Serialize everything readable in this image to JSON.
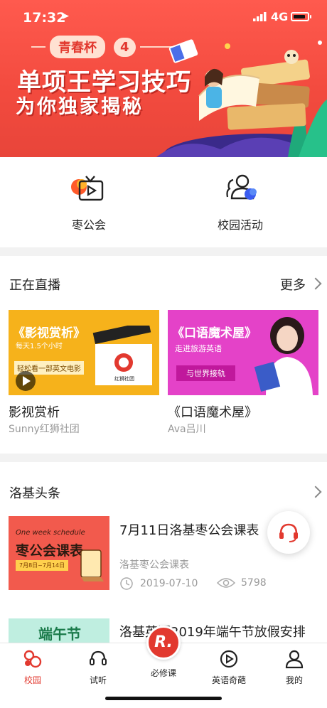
{
  "status": {
    "time": "17:32",
    "network": "4G"
  },
  "banner": {
    "tag": "青春杯",
    "tag_num": "4",
    "headline": "单项王学习技巧",
    "subline": "为你独家揭秘"
  },
  "categories": [
    {
      "label": "枣公会",
      "icon": "tv-play-icon"
    },
    {
      "label": "校园活动",
      "icon": "people-icon"
    }
  ],
  "live": {
    "section_title": "正在直播",
    "more_label": "更多",
    "cards": [
      {
        "poster_title": "《影视赏析》",
        "poster_line1": "每天1.5个小时",
        "poster_line2": "轻松看一部英文电影",
        "poster_brand": "红狮社团",
        "title": "影视赏析",
        "host": "Sunny红狮社团"
      },
      {
        "poster_title": "《口语魔术屋》",
        "poster_line1": "走进旅游英语",
        "poster_line2": "与世界接轨",
        "title": "《口语魔术屋》",
        "host": "Ava吕川"
      }
    ]
  },
  "news": {
    "section_title": "洛基头条",
    "items": [
      {
        "thumb_top": "One week schedule",
        "thumb_main": "枣公会课表",
        "thumb_date": "7月8日~7月14日",
        "title": "7月11日洛基枣公会课表",
        "source": "洛基枣公会课表",
        "date": "2019-07-10",
        "views": "5798"
      },
      {
        "thumb_main": "端午节",
        "title": "洛基英语2019年端午节放假安排"
      }
    ]
  },
  "tabbar": {
    "tabs": [
      {
        "label": "校园",
        "icon": "campus-icon",
        "active": true
      },
      {
        "label": "试听",
        "icon": "headset-icon",
        "active": false
      },
      {
        "label": "必修课",
        "icon": "logo-r-icon",
        "active": false
      },
      {
        "label": "英语奇葩",
        "icon": "play-circle-icon",
        "active": false
      },
      {
        "label": "我的",
        "icon": "user-icon",
        "active": false
      }
    ],
    "center_logo": "R."
  },
  "colors": {
    "brand": "#e2392f",
    "live_card_1": "#f6b21b",
    "live_card_2": "#e442c8"
  }
}
